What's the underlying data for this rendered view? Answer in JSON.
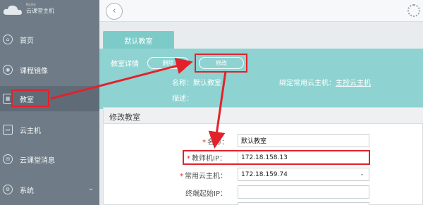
{
  "brand": {
    "name": "云课堂主机",
    "tagline": "Ruijie"
  },
  "sidebar": {
    "items": [
      {
        "label": "首页",
        "icon": "home-icon",
        "glyph": "⌂"
      },
      {
        "label": "课程镜像",
        "icon": "disc-icon",
        "glyph": "◉"
      },
      {
        "label": "教室",
        "icon": "classroom-icon",
        "glyph": "▦"
      },
      {
        "label": "云主机",
        "icon": "monitor-icon",
        "glyph": "▭"
      },
      {
        "label": "云课堂消息",
        "icon": "message-icon",
        "glyph": "✉"
      },
      {
        "label": "系统",
        "icon": "system-icon",
        "glyph": "⚙"
      }
    ],
    "active_index": 2
  },
  "topbar": {
    "back_glyph": "‹"
  },
  "tab": {
    "label": "默认教室"
  },
  "classroom": {
    "detail_label": "教室详情",
    "delete_label": "删除",
    "edit_label": "修改",
    "name_label": "名称：默认教室",
    "host_label": "绑定常用云主机：",
    "host_value": "主控云主机",
    "desc_label": "描述："
  },
  "dialog": {
    "title": "修改教室",
    "fields": {
      "name": {
        "label": "名称：",
        "value": "默认教室"
      },
      "teacher_ip": {
        "label": "教师机IP：",
        "value": "172.18.158.13"
      },
      "host": {
        "label": "常用云主机：",
        "value": "172.18.159.74"
      },
      "terminal_ip": {
        "label": "终端起始IP：",
        "value": ""
      }
    }
  },
  "colors": {
    "accent": "#8ed3d1",
    "sidebar": "#6f7c87",
    "highlight": "#e2222a"
  }
}
